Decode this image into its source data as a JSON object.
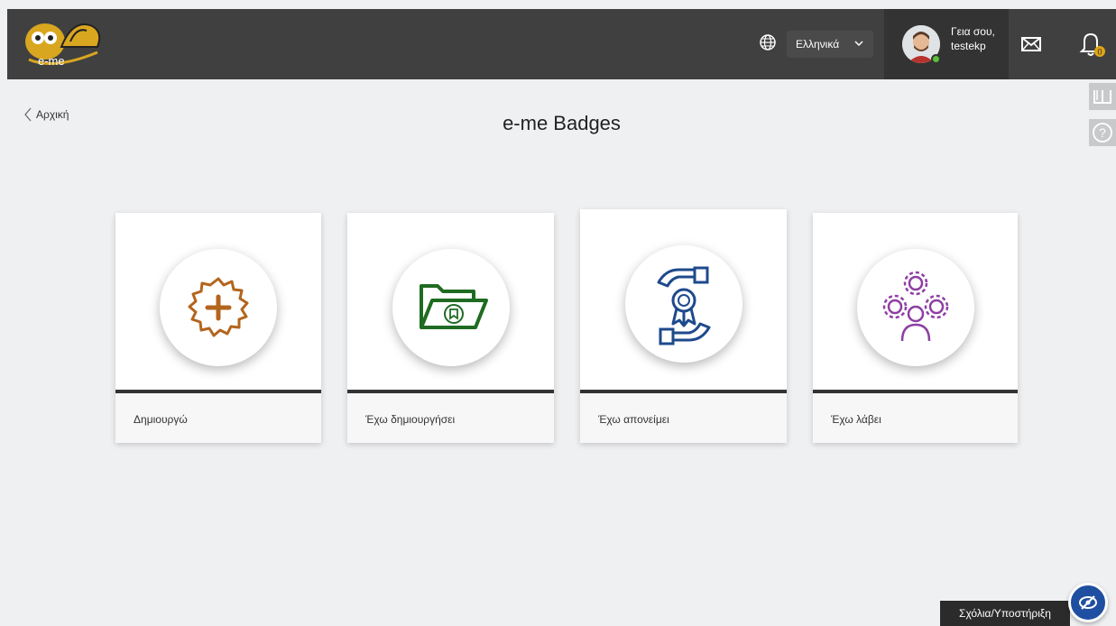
{
  "header": {
    "logo_text": "e-me",
    "language": "Ελληνικά",
    "greeting_line1": "Γεια σου,",
    "greeting_line2": "testekp",
    "notification_count": "0"
  },
  "nav": {
    "back_label": "Αρχική"
  },
  "page": {
    "title": "e-me Badges"
  },
  "cards": [
    {
      "label": "Δημιουργώ",
      "icon": "badge-plus-icon",
      "color": "#b3651c"
    },
    {
      "label": "Έχω δημιουργήσει",
      "icon": "folder-badge-icon",
      "color": "#1f6b22"
    },
    {
      "label": "Έχω απονείμει",
      "icon": "award-hands-icon",
      "color": "#1e4a8c"
    },
    {
      "label": "Έχω λάβει",
      "icon": "users-gears-icon",
      "color": "#8e3fa3"
    }
  ],
  "footer": {
    "feedback_label": "Σχόλια/Υποστήριξη"
  },
  "colors": {
    "topbar": "#404040",
    "background": "#eff0f2"
  }
}
